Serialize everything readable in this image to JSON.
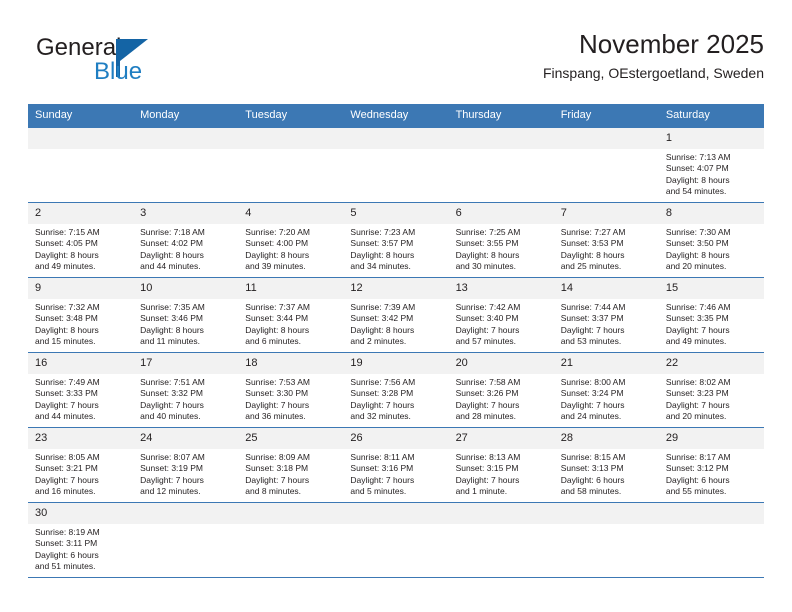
{
  "logo": {
    "primary_text": "General",
    "secondary_text": "Blue",
    "triangle_color": "#1464a5",
    "secondary_color": "#1f7ec2"
  },
  "header": {
    "title": "November 2025",
    "subtitle": "Finspang, OEstergoetland, Sweden"
  },
  "theme": {
    "header_bar_color": "#3c78b4",
    "daynum_background": "#f2f2f2",
    "grid_line_color": "#3c78b4",
    "text_color": "#231f20"
  },
  "weekdays": [
    "Sunday",
    "Monday",
    "Tuesday",
    "Wednesday",
    "Thursday",
    "Friday",
    "Saturday"
  ],
  "labels": {
    "sunrise_prefix": "Sunrise:",
    "sunset_prefix": "Sunset:",
    "daylight_prefix": "Daylight:"
  },
  "weeks": [
    [
      {
        "day": "",
        "empty": true
      },
      {
        "day": "",
        "empty": true
      },
      {
        "day": "",
        "empty": true
      },
      {
        "day": "",
        "empty": true
      },
      {
        "day": "",
        "empty": true
      },
      {
        "day": "",
        "empty": true
      },
      {
        "day": "1",
        "sunrise": "Sunrise: 7:13 AM",
        "sunset": "Sunset: 4:07 PM",
        "daylight_line1": "Daylight: 8 hours",
        "daylight_line2": "and 54 minutes."
      }
    ],
    [
      {
        "day": "2",
        "sunrise": "Sunrise: 7:15 AM",
        "sunset": "Sunset: 4:05 PM",
        "daylight_line1": "Daylight: 8 hours",
        "daylight_line2": "and 49 minutes."
      },
      {
        "day": "3",
        "sunrise": "Sunrise: 7:18 AM",
        "sunset": "Sunset: 4:02 PM",
        "daylight_line1": "Daylight: 8 hours",
        "daylight_line2": "and 44 minutes."
      },
      {
        "day": "4",
        "sunrise": "Sunrise: 7:20 AM",
        "sunset": "Sunset: 4:00 PM",
        "daylight_line1": "Daylight: 8 hours",
        "daylight_line2": "and 39 minutes."
      },
      {
        "day": "5",
        "sunrise": "Sunrise: 7:23 AM",
        "sunset": "Sunset: 3:57 PM",
        "daylight_line1": "Daylight: 8 hours",
        "daylight_line2": "and 34 minutes."
      },
      {
        "day": "6",
        "sunrise": "Sunrise: 7:25 AM",
        "sunset": "Sunset: 3:55 PM",
        "daylight_line1": "Daylight: 8 hours",
        "daylight_line2": "and 30 minutes."
      },
      {
        "day": "7",
        "sunrise": "Sunrise: 7:27 AM",
        "sunset": "Sunset: 3:53 PM",
        "daylight_line1": "Daylight: 8 hours",
        "daylight_line2": "and 25 minutes."
      },
      {
        "day": "8",
        "sunrise": "Sunrise: 7:30 AM",
        "sunset": "Sunset: 3:50 PM",
        "daylight_line1": "Daylight: 8 hours",
        "daylight_line2": "and 20 minutes."
      }
    ],
    [
      {
        "day": "9",
        "sunrise": "Sunrise: 7:32 AM",
        "sunset": "Sunset: 3:48 PM",
        "daylight_line1": "Daylight: 8 hours",
        "daylight_line2": "and 15 minutes."
      },
      {
        "day": "10",
        "sunrise": "Sunrise: 7:35 AM",
        "sunset": "Sunset: 3:46 PM",
        "daylight_line1": "Daylight: 8 hours",
        "daylight_line2": "and 11 minutes."
      },
      {
        "day": "11",
        "sunrise": "Sunrise: 7:37 AM",
        "sunset": "Sunset: 3:44 PM",
        "daylight_line1": "Daylight: 8 hours",
        "daylight_line2": "and 6 minutes."
      },
      {
        "day": "12",
        "sunrise": "Sunrise: 7:39 AM",
        "sunset": "Sunset: 3:42 PM",
        "daylight_line1": "Daylight: 8 hours",
        "daylight_line2": "and 2 minutes."
      },
      {
        "day": "13",
        "sunrise": "Sunrise: 7:42 AM",
        "sunset": "Sunset: 3:40 PM",
        "daylight_line1": "Daylight: 7 hours",
        "daylight_line2": "and 57 minutes."
      },
      {
        "day": "14",
        "sunrise": "Sunrise: 7:44 AM",
        "sunset": "Sunset: 3:37 PM",
        "daylight_line1": "Daylight: 7 hours",
        "daylight_line2": "and 53 minutes."
      },
      {
        "day": "15",
        "sunrise": "Sunrise: 7:46 AM",
        "sunset": "Sunset: 3:35 PM",
        "daylight_line1": "Daylight: 7 hours",
        "daylight_line2": "and 49 minutes."
      }
    ],
    [
      {
        "day": "16",
        "sunrise": "Sunrise: 7:49 AM",
        "sunset": "Sunset: 3:33 PM",
        "daylight_line1": "Daylight: 7 hours",
        "daylight_line2": "and 44 minutes."
      },
      {
        "day": "17",
        "sunrise": "Sunrise: 7:51 AM",
        "sunset": "Sunset: 3:32 PM",
        "daylight_line1": "Daylight: 7 hours",
        "daylight_line2": "and 40 minutes."
      },
      {
        "day": "18",
        "sunrise": "Sunrise: 7:53 AM",
        "sunset": "Sunset: 3:30 PM",
        "daylight_line1": "Daylight: 7 hours",
        "daylight_line2": "and 36 minutes."
      },
      {
        "day": "19",
        "sunrise": "Sunrise: 7:56 AM",
        "sunset": "Sunset: 3:28 PM",
        "daylight_line1": "Daylight: 7 hours",
        "daylight_line2": "and 32 minutes."
      },
      {
        "day": "20",
        "sunrise": "Sunrise: 7:58 AM",
        "sunset": "Sunset: 3:26 PM",
        "daylight_line1": "Daylight: 7 hours",
        "daylight_line2": "and 28 minutes."
      },
      {
        "day": "21",
        "sunrise": "Sunrise: 8:00 AM",
        "sunset": "Sunset: 3:24 PM",
        "daylight_line1": "Daylight: 7 hours",
        "daylight_line2": "and 24 minutes."
      },
      {
        "day": "22",
        "sunrise": "Sunrise: 8:02 AM",
        "sunset": "Sunset: 3:23 PM",
        "daylight_line1": "Daylight: 7 hours",
        "daylight_line2": "and 20 minutes."
      }
    ],
    [
      {
        "day": "23",
        "sunrise": "Sunrise: 8:05 AM",
        "sunset": "Sunset: 3:21 PM",
        "daylight_line1": "Daylight: 7 hours",
        "daylight_line2": "and 16 minutes."
      },
      {
        "day": "24",
        "sunrise": "Sunrise: 8:07 AM",
        "sunset": "Sunset: 3:19 PM",
        "daylight_line1": "Daylight: 7 hours",
        "daylight_line2": "and 12 minutes."
      },
      {
        "day": "25",
        "sunrise": "Sunrise: 8:09 AM",
        "sunset": "Sunset: 3:18 PM",
        "daylight_line1": "Daylight: 7 hours",
        "daylight_line2": "and 8 minutes."
      },
      {
        "day": "26",
        "sunrise": "Sunrise: 8:11 AM",
        "sunset": "Sunset: 3:16 PM",
        "daylight_line1": "Daylight: 7 hours",
        "daylight_line2": "and 5 minutes."
      },
      {
        "day": "27",
        "sunrise": "Sunrise: 8:13 AM",
        "sunset": "Sunset: 3:15 PM",
        "daylight_line1": "Daylight: 7 hours",
        "daylight_line2": "and 1 minute."
      },
      {
        "day": "28",
        "sunrise": "Sunrise: 8:15 AM",
        "sunset": "Sunset: 3:13 PM",
        "daylight_line1": "Daylight: 6 hours",
        "daylight_line2": "and 58 minutes."
      },
      {
        "day": "29",
        "sunrise": "Sunrise: 8:17 AM",
        "sunset": "Sunset: 3:12 PM",
        "daylight_line1": "Daylight: 6 hours",
        "daylight_line2": "and 55 minutes."
      }
    ],
    [
      {
        "day": "30",
        "sunrise": "Sunrise: 8:19 AM",
        "sunset": "Sunset: 3:11 PM",
        "daylight_line1": "Daylight: 6 hours",
        "daylight_line2": "and 51 minutes."
      },
      {
        "day": "",
        "empty": true
      },
      {
        "day": "",
        "empty": true
      },
      {
        "day": "",
        "empty": true
      },
      {
        "day": "",
        "empty": true
      },
      {
        "day": "",
        "empty": true
      },
      {
        "day": "",
        "empty": true
      }
    ]
  ]
}
